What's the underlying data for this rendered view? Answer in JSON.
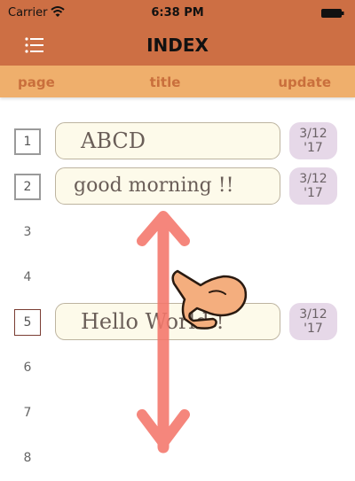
{
  "status_bar": {
    "carrier": "Carrier",
    "time": "6:38 PM"
  },
  "nav": {
    "title": "INDEX"
  },
  "columns": {
    "page": "page",
    "title": "title",
    "update": "update"
  },
  "rows": [
    {
      "page": "1",
      "title": "ABCD",
      "date_line1": "3/12",
      "date_line2": "'17"
    },
    {
      "page": "2",
      "title": "good morning !!",
      "date_line1": "3/12",
      "date_line2": "'17"
    },
    {
      "page": "3"
    },
    {
      "page": "4"
    },
    {
      "page": "5",
      "title": "Hello World !",
      "date_line1": "3/12",
      "date_line2": "'17"
    },
    {
      "page": "6"
    },
    {
      "page": "7"
    },
    {
      "page": "8"
    }
  ],
  "colors": {
    "nav_bar": "#cd6f44",
    "header_row": "#efaf6c",
    "header_text": "#c96f3c",
    "title_field": "#fdfaea",
    "date_badge": "#e6d8e8",
    "scroll_arrow": "#f4766a",
    "hand_pointer": "#f4ae7e"
  },
  "icons": [
    "wifi-icon",
    "battery-icon",
    "menu-icon",
    "scroll-arrow-icon",
    "hand-pointer-icon"
  ]
}
